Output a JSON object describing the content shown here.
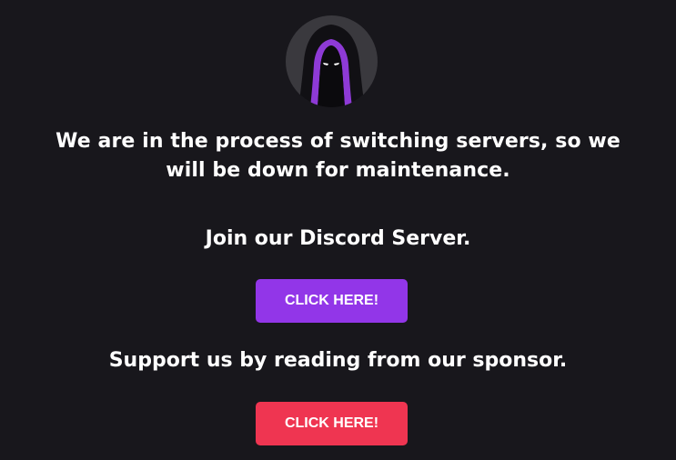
{
  "logo": {
    "icon": "hooded-figure-icon",
    "colors": {
      "circle": "#3a393e",
      "hood": "#111014",
      "accent": "#8e3ad6",
      "eyes": "#ffffff"
    }
  },
  "message": {
    "line1": "We are in the process of switching servers, so we",
    "line2": "will be down for maintenance."
  },
  "discord": {
    "text": "Join our Discord Server.",
    "button_label": "CLICK HERE!",
    "button_color": "#9236e8"
  },
  "sponsor": {
    "text": "Support us by reading from our sponsor.",
    "button_label": "CLICK HERE!",
    "button_color": "#ef3551"
  },
  "colors": {
    "background": "#18171c",
    "text": "#ffffff"
  }
}
